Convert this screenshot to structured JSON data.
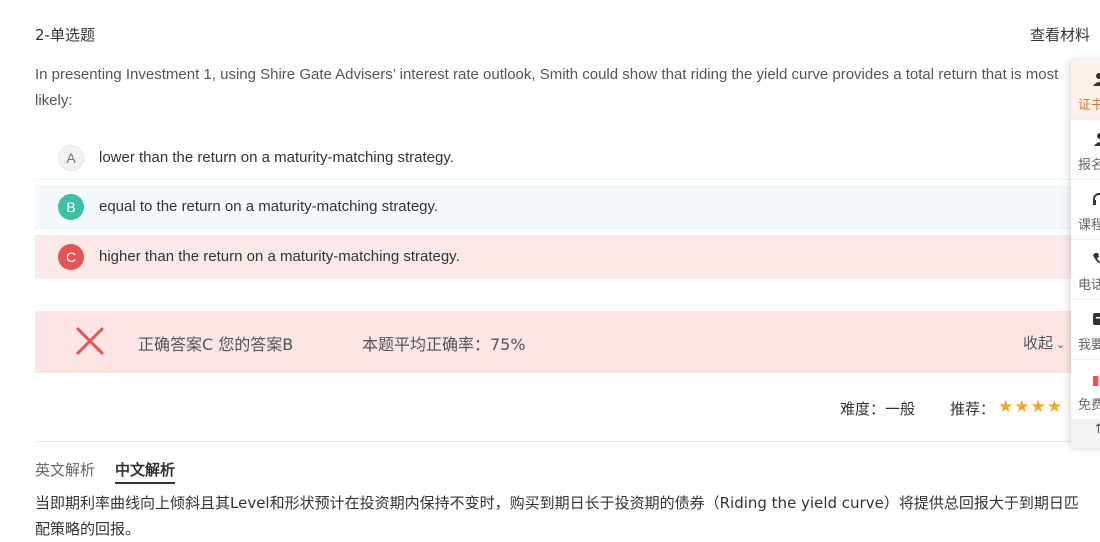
{
  "header": {
    "question_type": "2-单选题",
    "view_material": "查看材料"
  },
  "question": {
    "stem": "In presenting Investment 1, using Shire Gate Advisers’   interest rate outlook, Smith could show that riding the yield curve provides a total return that is most likely:"
  },
  "options": [
    {
      "letter": "A",
      "text": "lower than the return on a maturity-matching strategy.",
      "state": "default"
    },
    {
      "letter": "B",
      "text": "equal to the return on a maturity-matching strategy.",
      "state": "selected"
    },
    {
      "letter": "C",
      "text": "higher than the return on a maturity-matching strategy.",
      "state": "correct"
    }
  ],
  "result": {
    "answer_summary": "正确答案C 您的答案B",
    "avg_accuracy": "本题平均正确率：75%",
    "collapse_label": "收起",
    "status": "wrong"
  },
  "meta": {
    "difficulty": "难度：一般",
    "recommend": "推荐：",
    "stars": 4,
    "stars_glyphs": "★★★★"
  },
  "tabs": [
    {
      "label": "英文解析",
      "active": false
    },
    {
      "label": "中文解析",
      "active": true
    }
  ],
  "analysis": {
    "text": "当即期利率曲线向上倾斜且其Level和形状预计在投资期内保持不变时，购买到期日长于投资期的债券（Riding the yield curve）将提供总回报大于到期日匹配策略的回报。"
  },
  "side_panel": {
    "items": [
      {
        "label": "证书",
        "icon": "user-icon",
        "active": true
      },
      {
        "label": "报名",
        "icon": "users-icon",
        "active": false
      },
      {
        "label": "课程",
        "icon": "headset-icon",
        "active": false
      },
      {
        "label": "电话",
        "icon": "phone-icon",
        "active": false
      },
      {
        "label": "我要",
        "icon": "message-icon",
        "active": false
      },
      {
        "label": "免费",
        "icon": "gift-icon",
        "active": false
      }
    ],
    "bottom_arrow": "↑"
  },
  "colors": {
    "correct": "#e35454",
    "selected": "#3bbfa5",
    "star": "#f5a623",
    "side_active": "#e0702c"
  }
}
